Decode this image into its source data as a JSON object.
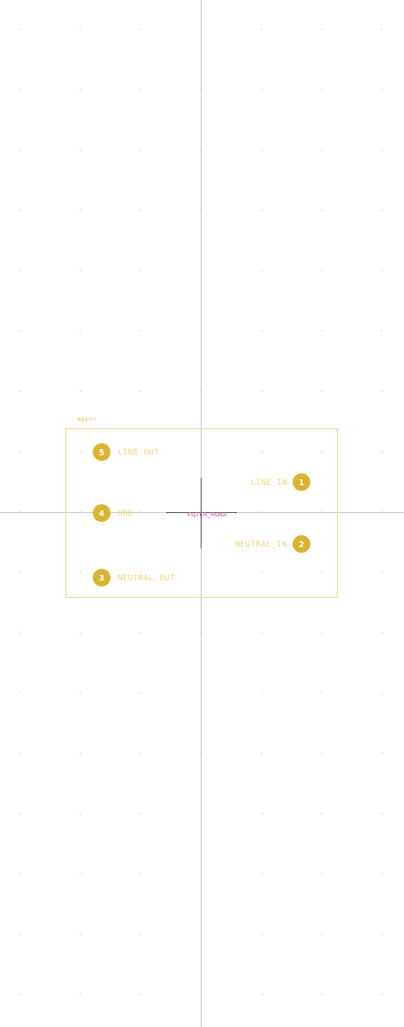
{
  "footprint": {
    "reference": "REF**",
    "value": "FILTER_PANA"
  },
  "pads": [
    {
      "number": "5",
      "name": "LINE_OUT"
    },
    {
      "number": "1",
      "name": "LINE_IN"
    },
    {
      "number": "4",
      "name": "GND"
    },
    {
      "number": "2",
      "name": "NEUTRAL_IN"
    },
    {
      "number": "3",
      "name": "NEUTRAL_OUT"
    }
  ],
  "colors": {
    "background": "#ffffff",
    "grid_dot": "#b8b8b8",
    "axis": "#c8c8c8",
    "silkscreen": "#f2d98a",
    "pad": "#d9b432",
    "pad_number": "#ffffff",
    "pad_label": "#f0d47a",
    "anchor": "#555555",
    "value_text": "#c05a9a"
  }
}
